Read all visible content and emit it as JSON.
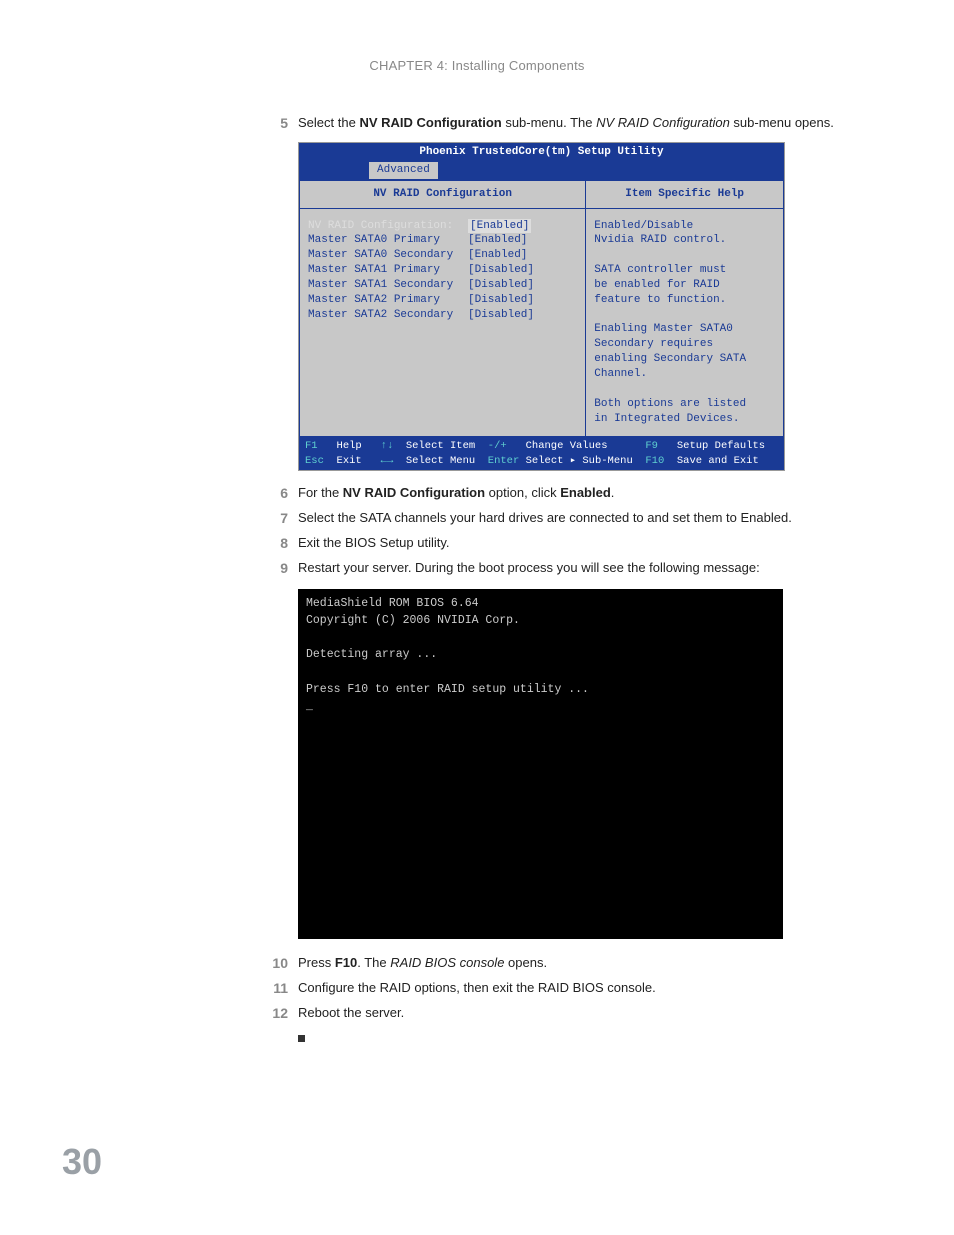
{
  "chapter_header": "CHAPTER 4: Installing Components",
  "page_number": "30",
  "steps": {
    "s5_num": "5",
    "s5_a": "Select the ",
    "s5_b": "NV RAID Configuration",
    "s5_c": " sub-menu. The ",
    "s5_d": "NV RAID Configuration",
    "s5_e": " sub-menu opens.",
    "s6_num": "6",
    "s6_a": "For the ",
    "s6_b": "NV RAID Configuration",
    "s6_c": " option, click ",
    "s6_d": "Enabled",
    "s6_e": ".",
    "s7_num": "7",
    "s7_text": "Select the SATA channels your hard drives are connected to and set them to Enabled.",
    "s8_num": "8",
    "s8_text": "Exit the BIOS Setup utility.",
    "s9_num": "9",
    "s9_text": "Restart your server. During the boot process you will see the following message:",
    "s10_num": "10",
    "s10_a": "Press ",
    "s10_b": "F10",
    "s10_c": ". The ",
    "s10_d": "RAID BIOS console",
    "s10_e": " opens.",
    "s11_num": "11",
    "s11_text": "Configure the RAID options, then exit the RAID BIOS console.",
    "s12_num": "12",
    "s12_text": "Reboot the server."
  },
  "bios": {
    "title": "Phoenix TrustedCore(tm) Setup Utility",
    "tab": "Advanced",
    "left_title": "NV RAID Configuration",
    "right_title": "Item Specific Help",
    "rows": [
      {
        "label": "NV RAID Configuration:",
        "value": "[Enabled]",
        "selected": true
      },
      {
        "label": "Master SATA0 Primary",
        "value": "[Enabled]",
        "selected": false
      },
      {
        "label": "Master SATA0 Secondary",
        "value": "[Enabled]",
        "selected": false
      },
      {
        "label": "Master SATA1 Primary",
        "value": "[Disabled]",
        "selected": false
      },
      {
        "label": "Master SATA1 Secondary",
        "value": "[Disabled]",
        "selected": false
      },
      {
        "label": "Master SATA2 Primary",
        "value": "[Disabled]",
        "selected": false
      },
      {
        "label": "Master SATA2 Secondary",
        "value": "[Disabled]",
        "selected": false
      }
    ],
    "help_text": "Enabled/Disable\nNvidia RAID control.\n\nSATA controller must\nbe enabled for RAID\nfeature to function.\n\nEnabling Master SATA0\nSecondary requires\nenabling Secondary SATA\nChannel.\n\nBoth options are listed\nin Integrated Devices.",
    "footer": {
      "f1": "F1",
      "help": "Help",
      "up": "↑↓",
      "selitem": "Select Item",
      "pm": "-/+",
      "chval": "Change Values",
      "f9": "F9",
      "defaults": "Setup Defaults",
      "esc": "Esc",
      "exit": "Exit",
      "lr": "←→",
      "selmenu": "Select Menu",
      "ent": "Enter",
      "sub": "Select ▸ Sub-Menu",
      "f10": "F10",
      "save": "Save and Exit"
    }
  },
  "black": {
    "line1": "MediaShield ROM BIOS 6.64",
    "line2": "Copyright (C) 2006 NVIDIA Corp.",
    "line3": "Detecting array ...",
    "line4": "Press F10  to enter RAID setup utility ...",
    "cursor": "_"
  }
}
